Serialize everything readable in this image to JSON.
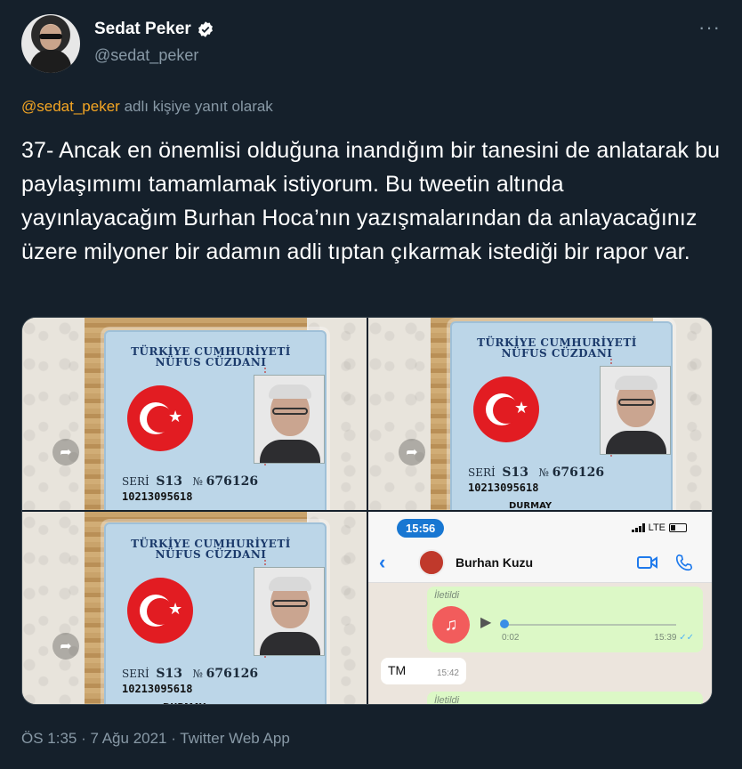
{
  "author": {
    "name": "Sedat Peker",
    "handle": "@sedat_peker",
    "verified_icon": "verified-badge-icon",
    "more_label": "···"
  },
  "reply": {
    "mention": "@sedat_peker",
    "suffix": "adlı kişiye yanıt olarak"
  },
  "tweet": {
    "text": "37- Ancak en önemlisi olduğuna inandığım bir tanesini de anlatarak bu paylaşımımı tamamlamak istiyorum. Bu tweetin altında yayınlayacağım Burhan Hoca’nın yazışmalarından da anlayacağınız üzere milyoner bir adamın adli tıptan çıkarmak istediği bir rapor var."
  },
  "id_card": {
    "title_line1": "TÜRKİYE CUMHURİYETİ",
    "title_line2": "NÜFUS CÜZDANI",
    "serial_label": "SERİ",
    "serial_value": "S13",
    "number_label": "№",
    "number_value": "676126",
    "id_number": "10213095618",
    "surname": "DURMAY"
  },
  "chat": {
    "time": "15:56",
    "network": "LTE",
    "contact": "Burhan Kuzu",
    "forwarded_label": "İletildi",
    "audio_duration": "0:02",
    "audio_time": "15:39",
    "ticks": "✓✓",
    "incoming_text": "TM",
    "incoming_time": "15:42"
  },
  "meta": {
    "timestamp": "ÖS 1:35 · 7 Ağu 2021 · Twitter Web App"
  },
  "colors": {
    "background": "#15202b",
    "mention": "#f5a623",
    "muted": "#8899a6",
    "text": "#ffffff"
  }
}
